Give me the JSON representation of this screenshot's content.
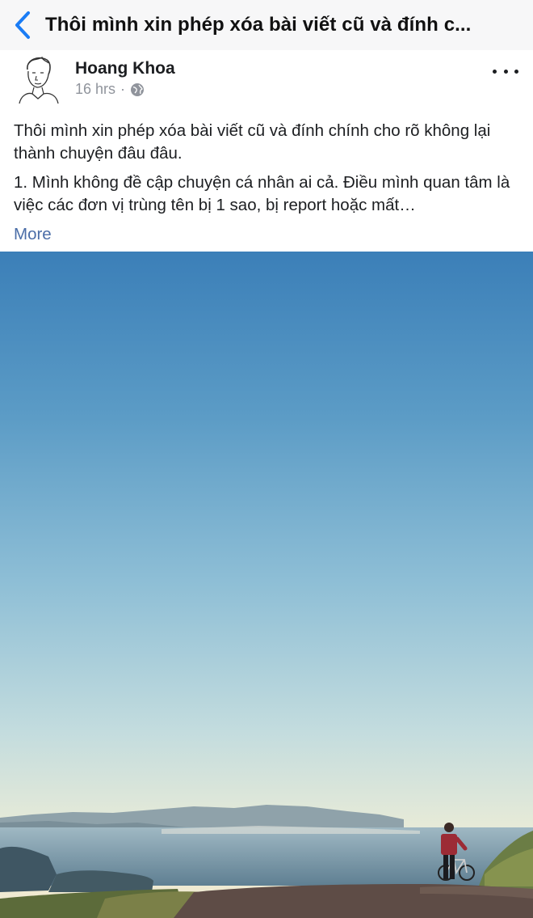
{
  "nav": {
    "back_icon": "chevron-left-icon",
    "title": "Thôi mình xin phép xóa bài viết cũ và đính c..."
  },
  "post": {
    "author": "Hoang Khoa",
    "timestamp": "16 hrs",
    "privacy_icon": "globe-icon",
    "menu_icon": "more-options-icon",
    "paragraphs": [
      "Thôi mình xin phép xóa bài viết cũ và đính chính cho rõ không lại thành chuyện đâu đâu.",
      "1. Mình không đề cập chuyện cá nhân ai cả. Điều mình quan tâm là việc các đơn vị trùng tên bị 1 sao, bị report hoặc mất…"
    ],
    "more_label": "More"
  },
  "colors": {
    "link": "#4b6ea8",
    "nav_back": "#1a7cf5",
    "meta": "#90949c"
  }
}
